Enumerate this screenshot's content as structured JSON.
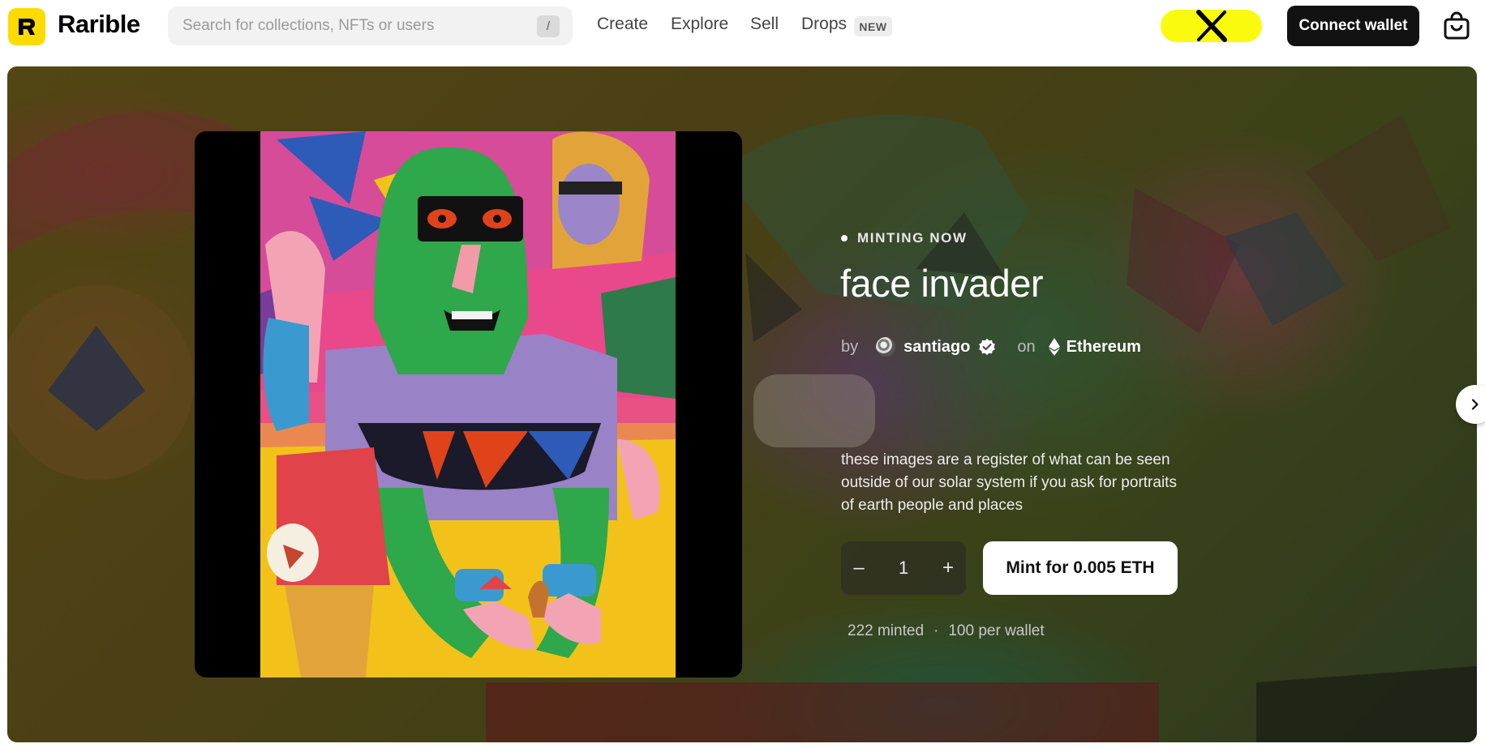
{
  "header": {
    "logo_letter": "R",
    "brand": "Rarible",
    "search": {
      "placeholder": "Search for collections, NFTs or users",
      "shortcut": "/"
    },
    "nav": [
      "Create",
      "Explore",
      "Sell",
      "Drops"
    ],
    "drops_badge": "NEW",
    "connect_wallet": "Connect wallet",
    "icons": {
      "promo": "x-logo-icon",
      "cart": "shopping-bag-icon"
    },
    "colors": {
      "brand_yellow": "#FEDA03",
      "promo_yellow": "#FAFA0E",
      "button_dark": "#121212"
    }
  },
  "hero": {
    "status": "MINTING NOW",
    "title": "face invader",
    "by_label": "by",
    "creator": "santiago",
    "on_label": "on",
    "chain": "Ethereum",
    "description": "these images are a register of what can be seen outside of our solar system if you ask for portraits of earth people and places",
    "quantity": "1",
    "minus": "–",
    "plus": "+",
    "mint_button": "Mint for 0.005 ETH",
    "minted": "222 minted",
    "separator": "·",
    "per_wallet": "100 per wallet",
    "icons": {
      "verified": "verified-badge-icon",
      "chain": "ethereum-icon",
      "next": "chevron-right-icon"
    }
  }
}
